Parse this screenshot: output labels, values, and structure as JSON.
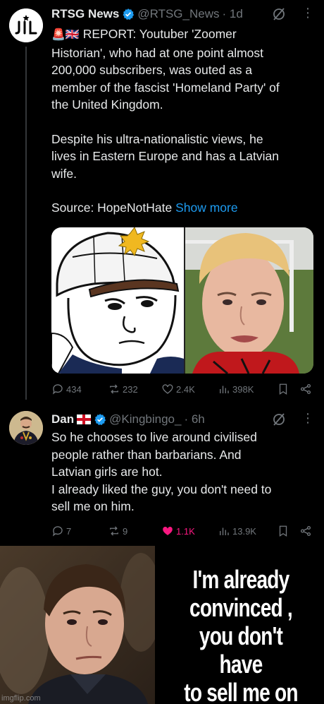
{
  "tweet1": {
    "avatar_text": "JIL",
    "name": "RTSG News",
    "handle": "@RTSG_News",
    "time": "· 1d",
    "body_line1_flags": "🚨🇬🇧",
    "body_line1": "REPORT: Youtuber 'Zoomer",
    "body_line2": "Historian', who had at one point almost",
    "body_line3": "200,000 subscribers, was outed as a",
    "body_line4": "member of the fascist 'Homeland Party' of",
    "body_line5": "the United Kingdom.",
    "body_line6": "Despite his ultra-nationalistic views, he",
    "body_line7": "lives in Eastern Europe and has a Latvian",
    "body_line8": "wife.",
    "source": "Source: HopeNotHate",
    "show_more": "Show more",
    "stats": {
      "replies": "434",
      "retweets": "232",
      "likes": "2.4K",
      "views": "398K"
    }
  },
  "tweet2": {
    "name": "Dan",
    "handle": "@Kingbingo_",
    "time": "· 6h",
    "body_line1": "So he chooses to live around civilised",
    "body_line2": "people rather than barbarians. And",
    "body_line3": "Latvian girls are hot.",
    "body_line4": "I already liked the guy, you don't need to",
    "body_line5": "sell me on him.",
    "stats": {
      "replies": "7",
      "retweets": "9",
      "likes": "1.1K",
      "views": "13.9K"
    }
  },
  "meme": {
    "line1": "I'm already",
    "line2": "convinced ,",
    "line3": "you don't have",
    "line4": "to sell me on it",
    "watermark": "imgflip.com"
  },
  "colors": {
    "background": "#000000",
    "text": "#e7e9ea",
    "muted": "#71767b",
    "link": "#1d9bf0",
    "verified": "#1d9bf0",
    "like_active": "#f91880"
  }
}
